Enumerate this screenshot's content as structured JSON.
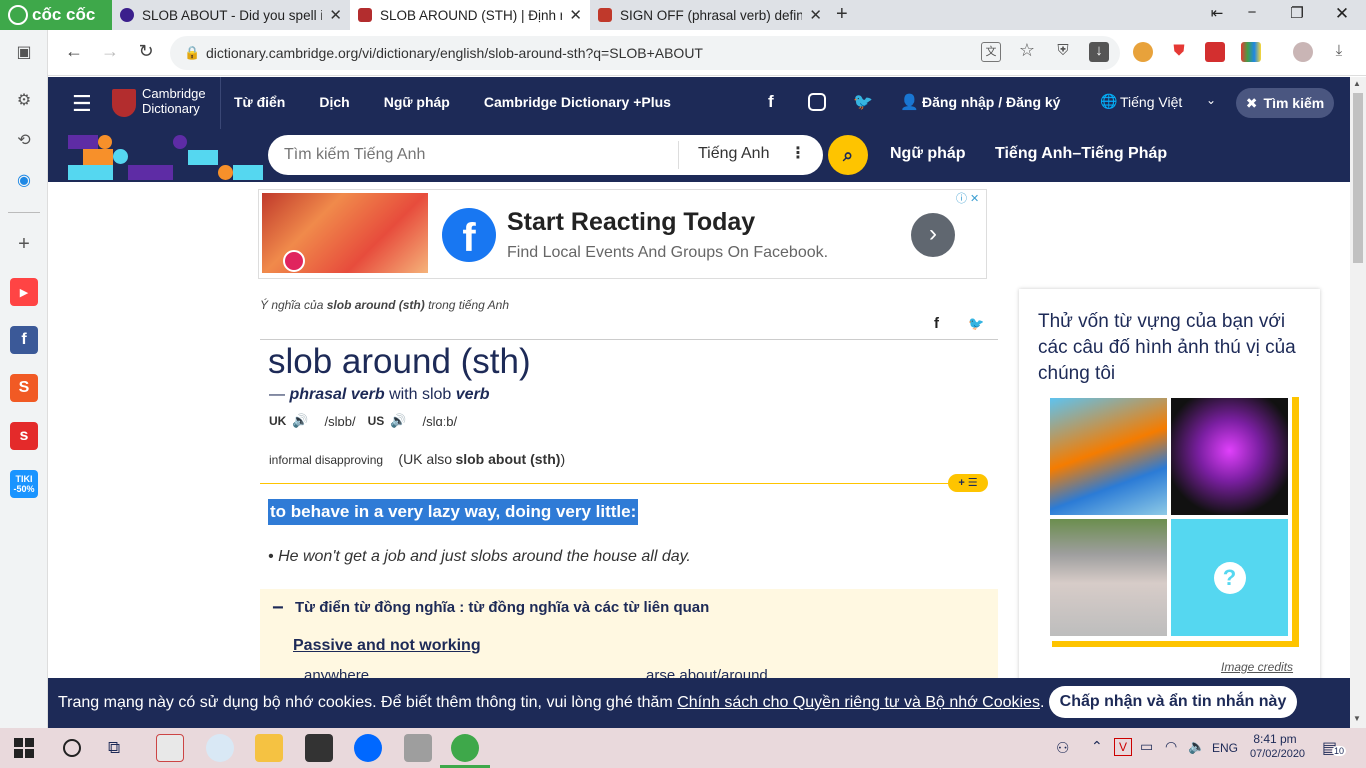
{
  "browser": {
    "brand": "cốc cốc",
    "tabs": [
      {
        "title": "SLOB ABOUT - Did you spell it",
        "favicon_color": "#3b1f8c"
      },
      {
        "title": "SLOB AROUND (STH) | Định nghĩa",
        "favicon_color": "#b32d2e",
        "active": true
      },
      {
        "title": "SIGN OFF (phrasal verb) definition",
        "favicon_color": "#c0392b"
      }
    ],
    "new_tab": "+",
    "url": "dictionary.cambridge.org/vi/dictionary/english/slob-around-sth?q=SLOB+ABOUT",
    "window_buttons": [
      "−",
      "❐",
      "✕"
    ],
    "restore_icon": "⇤"
  },
  "sidebar_icons": [
    "window-icon",
    "settings-icon",
    "history-icon",
    "messenger-icon",
    "add-icon",
    "youtube-icon",
    "facebook-icon",
    "shopee-icon",
    "sendo-icon",
    "tiki-icon"
  ],
  "tiki_label": "TIKI -50%",
  "header": {
    "logo_line1": "Cambridge",
    "logo_line2": "Dictionary",
    "nav": [
      "Từ điển",
      "Dịch",
      "Ngữ pháp",
      "Cambridge Dictionary +Plus"
    ],
    "login": "Đăng nhập / Đăng ký",
    "language": "Tiếng Việt",
    "search_toggle": "Tìm kiếm"
  },
  "subheader": {
    "search_placeholder": "Tìm kiếm Tiếng Anh",
    "dict_select": "Tiếng Anh",
    "links": [
      "Ngữ pháp",
      "Tiếng Anh–Tiếng Pháp"
    ]
  },
  "ad": {
    "title": "Start Reacting Today",
    "subtitle": "Find Local Events And Groups On Facebook."
  },
  "entry": {
    "meaning_prefix": "Ý nghĩa của",
    "meaning_word": "slob around (sth)",
    "meaning_suffix": "trong tiếng Anh",
    "headword": "slob around (sth)",
    "pos_line_dash": "—",
    "pos": "phrasal verb",
    "with": "with slob",
    "pos2": "verb",
    "uk_label": "UK",
    "uk_ipa": "/slɒb/",
    "us_label": "US",
    "us_ipa": "/slɑːb/",
    "labels": "informal disapproving",
    "uk_also_open": "(UK also",
    "uk_also_word": "slob about (sth)",
    "uk_also_close": ")",
    "definition": "to behave in a very lazy way, doing very little:",
    "example": "He won't get a job and just slobs around the house all day.",
    "more_btn": "+ ☰",
    "thesaurus_title": "Từ điển từ đồng nghĩa : từ đồng nghĩa và các từ liên quan",
    "thesaurus_toggle": "−",
    "thesaurus_group": "Passive and not working",
    "thesaurus_words": [
      "anywhere",
      "arse about/around"
    ]
  },
  "quiz": {
    "title": "Thử vốn từ vựng của bạn với các câu đố hình ảnh thú vị của chúng tôi",
    "credits": "Image credits",
    "question_mark": "?"
  },
  "cookie": {
    "text": "Trang mạng này có sử dụng bộ nhớ cookies. Để biết thêm thông tin, vui lòng ghé thăm",
    "link": "Chính sách cho Quyền riêng tư và Bộ nhớ Cookies",
    "period": ".",
    "button": "Chấp nhận và ẩn tin nhắn này"
  },
  "taskbar": {
    "lang": "ENG",
    "time": "8:41 pm",
    "date": "07/02/2020",
    "notif_count": "10"
  }
}
